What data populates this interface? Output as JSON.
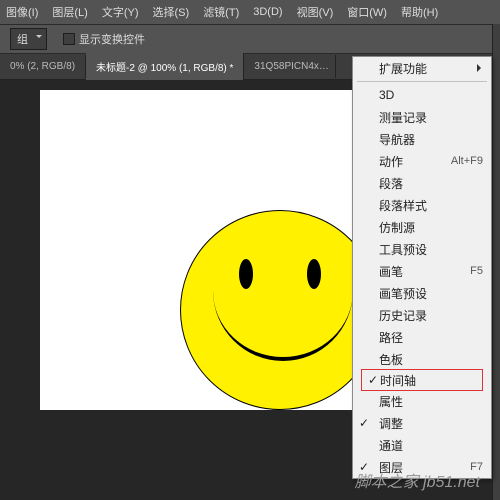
{
  "menubar": {
    "items": [
      {
        "label": "图像(I)"
      },
      {
        "label": "图层(L)"
      },
      {
        "label": "文字(Y)"
      },
      {
        "label": "选择(S)"
      },
      {
        "label": "滤镜(T)"
      },
      {
        "label": "3D(D)"
      },
      {
        "label": "视图(V)"
      },
      {
        "label": "窗口(W)"
      },
      {
        "label": "帮助(H)"
      }
    ]
  },
  "options": {
    "group": "组",
    "transform": "显示变换控件"
  },
  "tabs": [
    {
      "label": "0% (2, RGB/8)"
    },
    {
      "label": "未标题-2 @ 100% (1, RGB/8) *"
    },
    {
      "label": "31Q58PICN4x…"
    }
  ],
  "menu": {
    "ext": "扩展功能",
    "items": [
      {
        "label": "3D"
      },
      {
        "label": "测量记录"
      },
      {
        "label": "导航器"
      },
      {
        "label": "动作",
        "sc": "Alt+F9"
      },
      {
        "label": "段落"
      },
      {
        "label": "段落样式"
      },
      {
        "label": "仿制源"
      },
      {
        "label": "工具预设"
      },
      {
        "label": "画笔",
        "sc": "F5"
      },
      {
        "label": "画笔预设"
      },
      {
        "label": "历史记录"
      },
      {
        "label": "路径"
      },
      {
        "label": "色板"
      },
      {
        "label": "时间轴",
        "ck": true,
        "hl": true
      },
      {
        "label": "属性"
      },
      {
        "label": "调整",
        "ck": true
      },
      {
        "label": "通道"
      },
      {
        "label": "图层",
        "ck": true,
        "sc": "F7"
      }
    ]
  },
  "watermark": "脚本之家 jb51.net"
}
